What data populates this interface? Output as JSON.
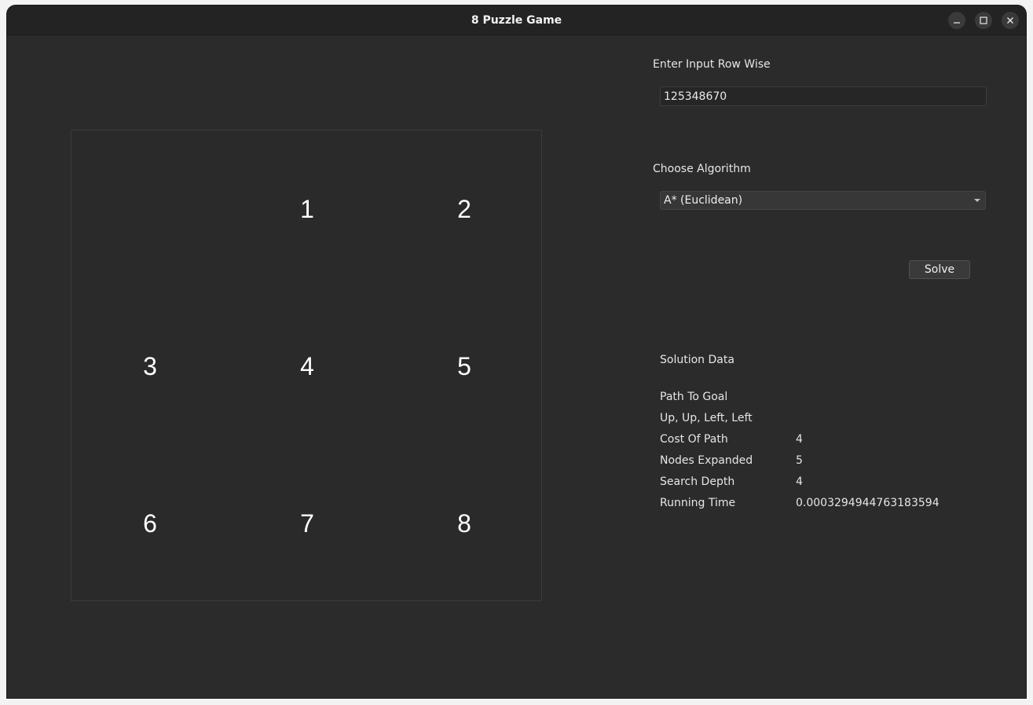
{
  "window": {
    "title": "8 Puzzle Game"
  },
  "board": {
    "tiles": [
      "",
      "1",
      "2",
      "3",
      "4",
      "5",
      "6",
      "7",
      "8"
    ]
  },
  "input_section": {
    "label": "Enter Input Row Wise",
    "value": "125348670"
  },
  "algorithm_section": {
    "label": "Choose Algorithm",
    "selected": "A* (Euclidean)"
  },
  "solve_button": {
    "label": "Solve"
  },
  "solution": {
    "heading": "Solution Data",
    "path_label": "Path To Goal",
    "path_value": "Up, Up, Left, Left",
    "cost_label": "Cost Of Path",
    "cost_value": "4",
    "nodes_label": "Nodes Expanded",
    "nodes_value": "5",
    "depth_label": "Search Depth",
    "depth_value": "4",
    "time_label": "Running Time",
    "time_value": "0.0003294944763183594"
  },
  "icons": {
    "minimize": "minimize-icon",
    "maximize": "maximize-icon",
    "close": "close-icon",
    "dropdown": "chevron-down-icon"
  },
  "colors": {
    "window_bg": "#2b2b2b",
    "titlebar_bg": "#232323",
    "text": "#e6e6e6"
  }
}
